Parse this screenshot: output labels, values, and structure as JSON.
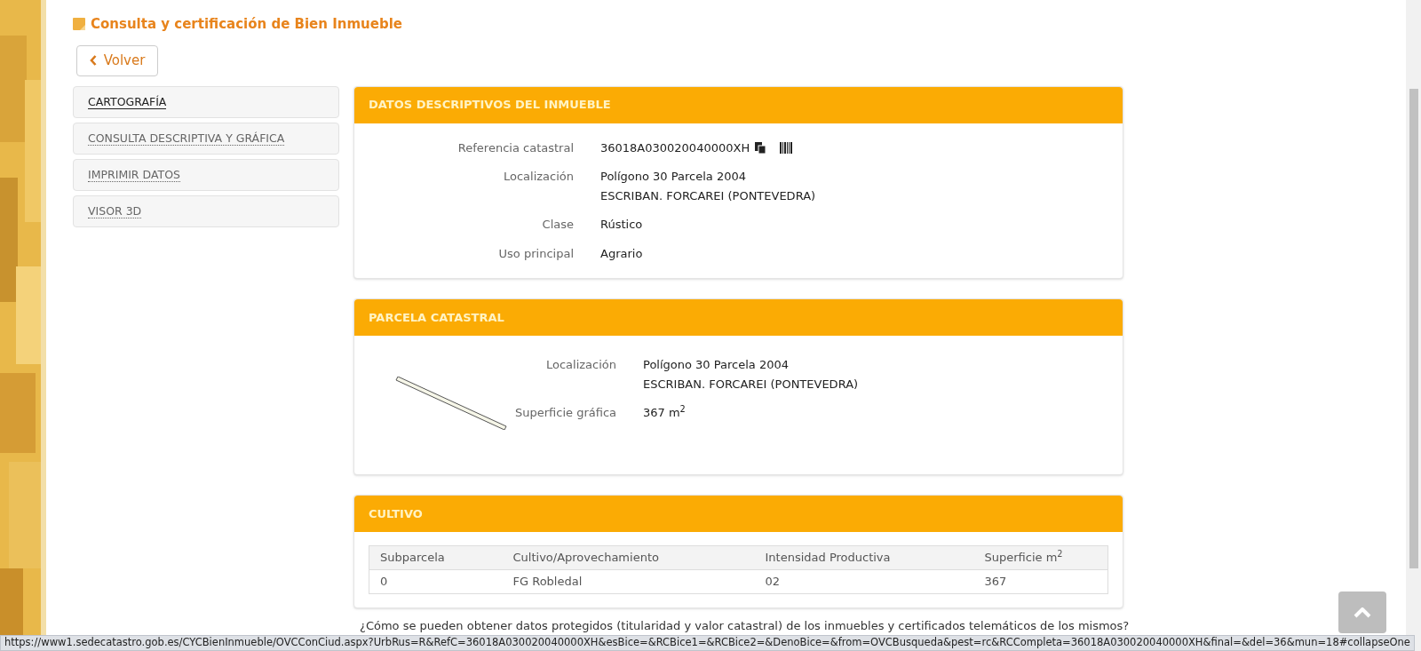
{
  "page_title": "Consulta y certificación de Bien Inmueble",
  "back_button": "Volver",
  "sidebar": {
    "items": [
      {
        "label": "CARTOGRAFÍA",
        "selected": true
      },
      {
        "label": "CONSULTA DESCRIPTIVA Y GRÁFICA",
        "selected": false
      },
      {
        "label": "IMPRIMIR DATOS",
        "selected": false
      },
      {
        "label": "VISOR 3D",
        "selected": false
      }
    ]
  },
  "datos": {
    "title": "DATOS DESCRIPTIVOS DEL INMUEBLE",
    "fields": [
      {
        "label": "Referencia catastral",
        "lines": [
          "36018A030020040000XH"
        ],
        "kind": "reference"
      },
      {
        "label": "Localización",
        "lines": [
          "Polígono 30 Parcela 2004",
          "ESCRIBAN. FORCAREI (PONTEVEDRA)"
        ],
        "kind": "text"
      },
      {
        "label": "Clase",
        "lines": [
          "Rústico"
        ],
        "kind": "text"
      },
      {
        "label": "Uso principal",
        "lines": [
          "Agrario"
        ],
        "kind": "text"
      }
    ]
  },
  "parcela": {
    "title": "PARCELA CATASTRAL",
    "fields": [
      {
        "label": "Localización",
        "lines": [
          "Polígono 30 Parcela 2004",
          "ESCRIBAN. FORCAREI (PONTEVEDRA)"
        ]
      },
      {
        "label": "Superficie gráfica",
        "lines": [
          "367 m$^{2}$"
        ]
      }
    ]
  },
  "cultivo": {
    "title": "CULTIVO",
    "columns": [
      "Subparcela",
      "Cultivo/Aprovechamiento",
      "Intensidad Productiva",
      "Superficie m$^{2}$"
    ],
    "rows": [
      [
        "0",
        "FG Robledal",
        "02",
        "367"
      ]
    ]
  },
  "help_link": "¿Cómo se pueden obtener datos protegidos (titularidad y valor catastral) de los inmuebles y certificados telemáticos de los mismos?",
  "status_bar": "https://www1.sedecatastro.gob.es/CYCBienInmueble/OVCConCiud.aspx?UrbRus=R&RefC=36018A030020040000XH&esBice=&RCBice1=&RCBice2=&DenoBice=&from=OVCBusqueda&pest=rc&RCCompleta=36018A030020040000XH&final=&del=36&mun=18#collapseOne"
}
